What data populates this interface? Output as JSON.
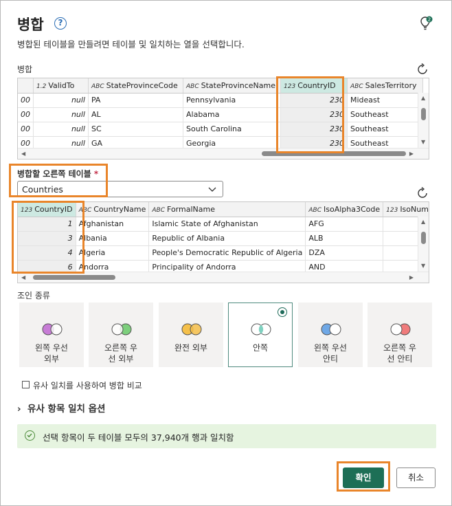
{
  "dialog": {
    "title": "병합",
    "description": "병합된 테이블을 만들려면 테이블 및 일치하는 열을 선택합니다."
  },
  "top_table": {
    "label": "병합",
    "columns": [
      {
        "type": "",
        "name": ""
      },
      {
        "type": "1.2",
        "name": "ValidTo"
      },
      {
        "type": "ABC",
        "name": "StateProvinceCode"
      },
      {
        "type": "ABC",
        "name": "StateProvinceName"
      },
      {
        "type": "123",
        "name": "CountryID"
      },
      {
        "type": "ABC",
        "name": "SalesTerritory"
      }
    ],
    "rows": [
      [
        "00",
        "null",
        "PA",
        "Pennsylvania",
        "230",
        "Mideast"
      ],
      [
        "00",
        "null",
        "AL",
        "Alabama",
        "230",
        "Southeast"
      ],
      [
        "00",
        "null",
        "SC",
        "South Carolina",
        "230",
        "Southeast"
      ],
      [
        "00",
        "null",
        "GA",
        "Georgia",
        "230",
        "Southeast"
      ]
    ]
  },
  "right_table": {
    "label": "병합할 오른쪽 테이블",
    "required_mark": "*",
    "selected": "Countries",
    "columns": [
      {
        "type": "123",
        "name": "CountryID"
      },
      {
        "type": "ABC",
        "name": "CountryName"
      },
      {
        "type": "ABC",
        "name": "FormalName"
      },
      {
        "type": "ABC",
        "name": "IsoAlpha3Code"
      },
      {
        "type": "123",
        "name": "IsoNum"
      }
    ],
    "rows": [
      [
        "1",
        "Afghanistan",
        "Islamic State of Afghanistan",
        "AFG",
        ""
      ],
      [
        "3",
        "Albania",
        "Republic of Albania",
        "ALB",
        ""
      ],
      [
        "4",
        "Algeria",
        "People's Democratic Republic of Algeria",
        "DZA",
        ""
      ],
      [
        "6",
        "Andorra",
        "Principality of Andorra",
        "AND",
        ""
      ]
    ]
  },
  "join": {
    "label": "조인 종류",
    "options": [
      {
        "line1": "왼쪽 우선",
        "line2": "외부",
        "left_color": "#c77cd6",
        "right_color": "#ffffff"
      },
      {
        "line1": "오른쪽 우",
        "line2": "선 외부",
        "left_color": "#ffffff",
        "right_color": "#7ccf7c"
      },
      {
        "line1": "완전 외부",
        "line2": "",
        "left_color": "#f5c04a",
        "right_color": "#f5c04a"
      },
      {
        "line1": "안쪽",
        "line2": "",
        "left_color": "#ffffff",
        "right_color": "#ffffff"
      },
      {
        "line1": "왼쪽 우선",
        "line2": "안티",
        "left_color": "#6fa8e6",
        "right_color": "#ffffff"
      },
      {
        "line1": "오른쪽 우",
        "line2": "선 안티",
        "left_color": "#ffffff",
        "right_color": "#f07c7c"
      }
    ],
    "selected_index": 3,
    "accent": "#1f6b5a"
  },
  "fuzzy": {
    "checkbox_label": "유사 일치를 사용하여 병합 비교",
    "options_label": "유사 항목 일치 옵션"
  },
  "status": {
    "text": "선택 항목이 두 테이블 모두의 37,940개 행과 일치함"
  },
  "buttons": {
    "ok": "확인",
    "cancel": "취소"
  },
  "colors": {
    "highlight": "#e9852a",
    "primary": "#1d6f56",
    "success_bg": "#e6f4e0"
  }
}
